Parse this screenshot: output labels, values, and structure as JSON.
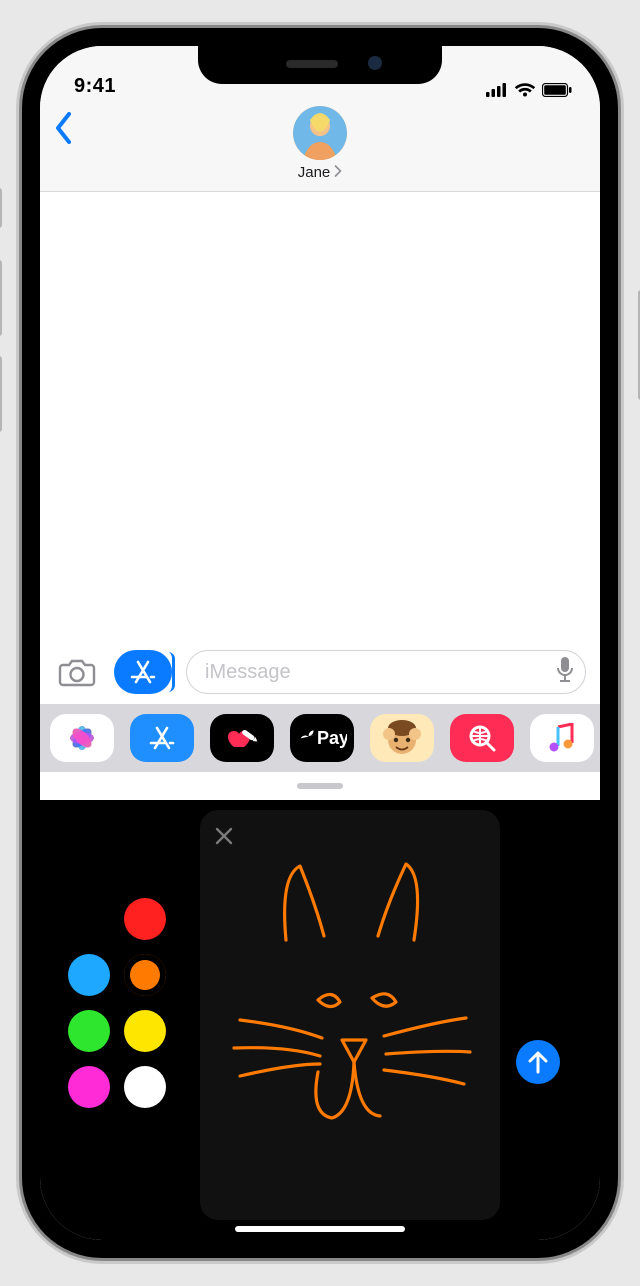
{
  "status": {
    "time": "9:41"
  },
  "header": {
    "contact_name": "Jane"
  },
  "input": {
    "placeholder": "iMessage"
  },
  "apps": {
    "photos": "Photos",
    "appstore": "App Store",
    "digitaltouch": "Digital Touch",
    "applepay_label": "Pay",
    "memoji": "Memoji",
    "images_search": "#images",
    "music": "Music"
  },
  "digital_touch": {
    "colors": [
      {
        "name": "red",
        "hex": "#ff2020"
      },
      {
        "name": "blue",
        "hex": "#1fa8ff"
      },
      {
        "name": "orange",
        "hex": "#ff7a00",
        "selected": true
      },
      {
        "name": "green",
        "hex": "#2fe62f"
      },
      {
        "name": "yellow",
        "hex": "#ffe600"
      },
      {
        "name": "magenta",
        "hex": "#ff2bd6"
      },
      {
        "name": "white",
        "hex": "#ffffff"
      }
    ],
    "drawing_subject": "cat face doodle",
    "stroke_color": "#ff7a00"
  }
}
